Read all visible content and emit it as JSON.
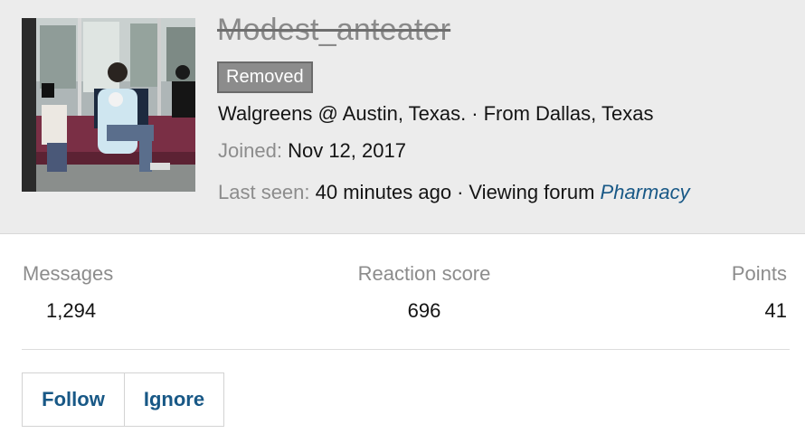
{
  "profile": {
    "username": "Modest_anteater",
    "status_badge": "Removed",
    "location_line": "Walgreens @ Austin, Texas.",
    "location_sep": "·",
    "from_text": "From Dallas, Texas",
    "joined_label": "Joined:",
    "joined_value": "Nov 12, 2017",
    "last_seen_label": "Last seen:",
    "last_seen_value": "40 minutes ago",
    "activity_sep": "·",
    "activity_text": "Viewing forum",
    "forum_link": "Pharmacy"
  },
  "stats": {
    "messages_label": "Messages",
    "messages_value": "1,294",
    "reaction_label": "Reaction score",
    "reaction_value": "696",
    "points_label": "Points",
    "points_value": "41"
  },
  "actions": {
    "follow_label": "Follow",
    "ignore_label": "Ignore"
  },
  "colors": {
    "header_bg": "#ececec",
    "link": "#185886",
    "badge_bg": "#8c8c8c",
    "muted": "#8c8c8c"
  }
}
